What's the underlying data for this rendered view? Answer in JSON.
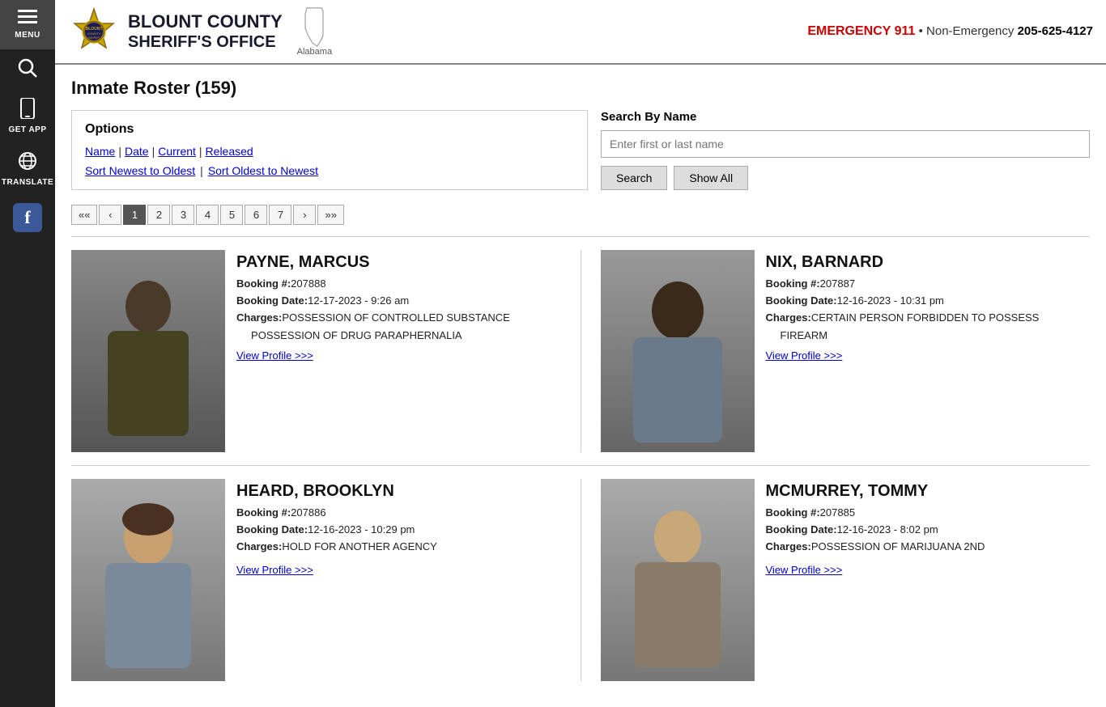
{
  "sidebar": {
    "menu_label": "MENU",
    "search_label": "Search",
    "get_app_label": "GET APP",
    "translate_label": "TRANSLATE",
    "facebook_label": "f"
  },
  "header": {
    "title_line1": "BLOUNT COUNTY",
    "title_line2": "SHERIFF'S OFFICE",
    "alabama_label": "Alabama",
    "emergency_label": "EMERGENCY 911",
    "separator": "•",
    "non_emergency_label": "Non-Emergency",
    "non_emergency_number": "205-625-4127"
  },
  "page": {
    "title": "Inmate Roster (159)"
  },
  "options": {
    "title": "Options",
    "links": [
      "Name",
      "Date",
      "Current",
      "Released"
    ],
    "sort_newest": "Sort Newest to Oldest",
    "sort_oldest": "Sort Oldest to Newest"
  },
  "search": {
    "label": "Search By Name",
    "placeholder": "Enter first or last name",
    "search_button": "Search",
    "show_all_button": "Show All"
  },
  "pagination": {
    "first": "<<",
    "prev": "<",
    "pages": [
      "1",
      "2",
      "3",
      "4",
      "5",
      "6",
      "7"
    ],
    "active_page": "1",
    "next": ">",
    "last": ">>"
  },
  "inmates": [
    {
      "name": "PAYNE, MARCUS",
      "booking_num_label": "Booking #:",
      "booking_num": "207888",
      "booking_date_label": "Booking Date:",
      "booking_date": "12-17-2023 - 9:26 am",
      "charges_label": "Charges:",
      "charges": [
        "POSSESSION OF CONTROLLED SUBSTANCE",
        "POSSESSION OF DRUG PARAPHERNALIA"
      ],
      "view_profile": "View Profile >>>"
    },
    {
      "name": "NIX, BARNARD",
      "booking_num_label": "Booking #:",
      "booking_num": "207887",
      "booking_date_label": "Booking Date:",
      "booking_date": "12-16-2023 - 10:31 pm",
      "charges_label": "Charges:",
      "charges": [
        "CERTAIN PERSON FORBIDDEN TO POSSESS FIREARM"
      ],
      "view_profile": "View Profile >>>"
    },
    {
      "name": "HEARD, BROOKLYN",
      "booking_num_label": "Booking #:",
      "booking_num": "207886",
      "booking_date_label": "Booking Date:",
      "booking_date": "12-16-2023 - 10:29 pm",
      "charges_label": "Charges:",
      "charges": [
        "HOLD FOR ANOTHER AGENCY"
      ],
      "view_profile": "View Profile >>>"
    },
    {
      "name": "MCMURREY, TOMMY",
      "booking_num_label": "Booking #:",
      "booking_num": "207885",
      "booking_date_label": "Booking Date:",
      "booking_date": "12-16-2023 - 8:02 pm",
      "charges_label": "Charges:",
      "charges": [
        "POSSESSION OF MARIJUANA 2ND"
      ],
      "view_profile": "View Profile >>>"
    }
  ]
}
